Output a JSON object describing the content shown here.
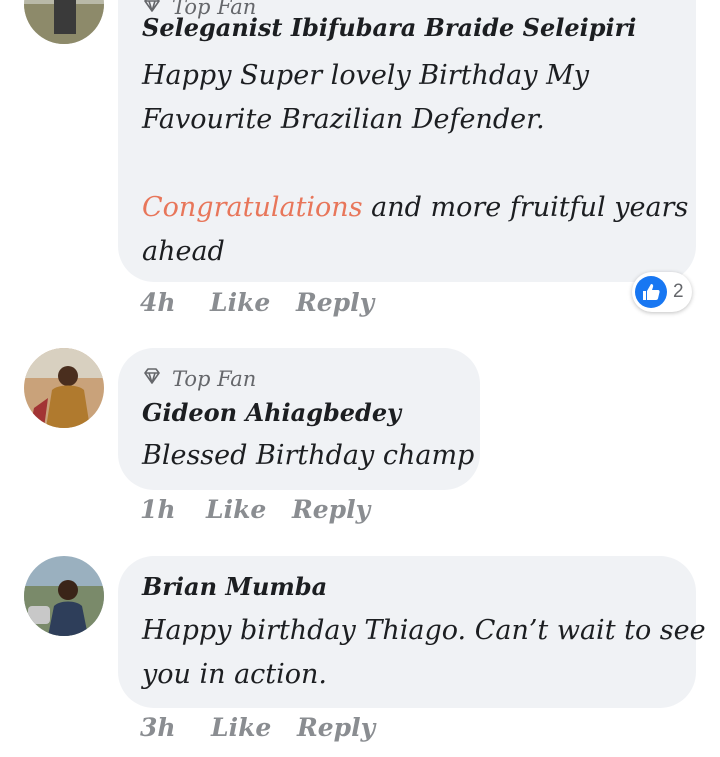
{
  "comments": [
    {
      "badge": "Top Fan",
      "author": "Seleganist Ibifubara Braide Seleipiri",
      "lines": [
        "Happy Super lovely Birthday My",
        "Favourite Brazilian Defender.",
        "",
        "and more fruitful years",
        "ahead"
      ],
      "link_text": "Congratulations",
      "time": "4h",
      "like": "Like",
      "reply": "Reply",
      "reaction_icon": "like-icon",
      "reaction_count": "2"
    },
    {
      "badge": "Top Fan",
      "author": "Gideon Ahiagbedey",
      "lines": [
        "Blessed Birthday champ"
      ],
      "time": "1h",
      "like": "Like",
      "reply": "Reply"
    },
    {
      "author": "Brian Mumba",
      "lines": [
        "Happy birthday Thiago. Can’t wait to see",
        "you in action."
      ],
      "time": "3h",
      "like": "Like",
      "reply": "Reply"
    }
  ],
  "colors": {
    "bubble": "#f0f2f5",
    "link": "#e8765a",
    "meta": "#8a8d91",
    "like_blue": "#1877f2"
  }
}
